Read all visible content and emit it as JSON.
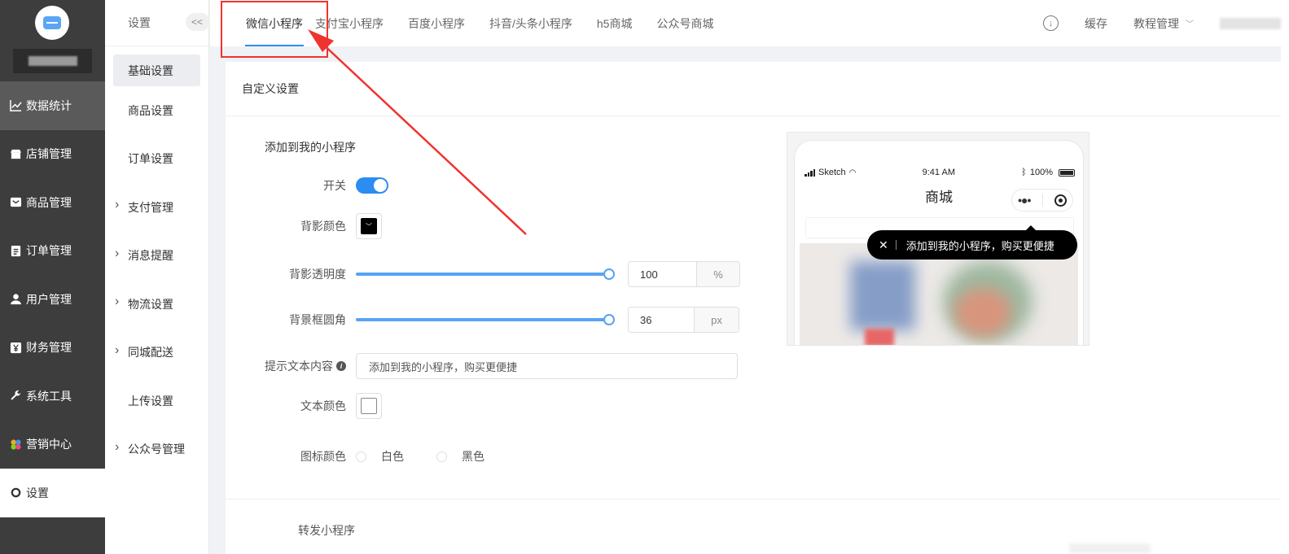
{
  "sidebar": {
    "items": [
      {
        "label": "数据统计",
        "icon": "line-chart-icon"
      },
      {
        "label": "店铺管理",
        "icon": "shop-icon"
      },
      {
        "label": "商品管理",
        "icon": "inbox-icon"
      },
      {
        "label": "订单管理",
        "icon": "clipboard-icon"
      },
      {
        "label": "用户管理",
        "icon": "user-icon"
      },
      {
        "label": "财务管理",
        "icon": "yen-icon"
      },
      {
        "label": "系统工具",
        "icon": "wrench-icon"
      },
      {
        "label": "营销中心",
        "icon": "marketing-icon"
      },
      {
        "label": "设置",
        "icon": "gear-icon"
      }
    ]
  },
  "subnav": {
    "title": "设置",
    "collapse": "<<",
    "items": [
      {
        "label": "基础设置"
      },
      {
        "label": "商品设置"
      },
      {
        "label": "订单设置"
      },
      {
        "label": "支付管理"
      },
      {
        "label": "消息提醒"
      },
      {
        "label": "物流设置"
      },
      {
        "label": "同城配送"
      },
      {
        "label": "上传设置"
      },
      {
        "label": "公众号管理"
      }
    ]
  },
  "tabs": [
    {
      "label": "微信小程序"
    },
    {
      "label": "支付宝小程序"
    },
    {
      "label": "百度小程序"
    },
    {
      "label": "抖音/头条小程序"
    },
    {
      "label": "h5商城"
    },
    {
      "label": "公众号商城"
    }
  ],
  "topright": {
    "cache": "缓存",
    "tutorial": "教程管理"
  },
  "card": {
    "title": "自定义设置",
    "section": "添加到我的小程序",
    "switch_label": "开关",
    "bg_color_label": "背影颜色",
    "bg_color": "#000000",
    "opacity_label": "背影透明度",
    "opacity_value": "100",
    "opacity_unit": "%",
    "radius_label": "背景框圆角",
    "radius_value": "36",
    "radius_unit": "px",
    "tip_label": "提示文本内容",
    "tip_value": "添加到我的小程序，购买更便捷",
    "text_color_label": "文本颜色",
    "text_color": "#ffffff",
    "icon_color_label": "图标颜色",
    "icon_options": [
      "白色",
      "黑色"
    ],
    "forward_label": "转发小程序"
  },
  "preview": {
    "carrier": "Sketch",
    "time": "9:41 AM",
    "battery": "100%",
    "title": "商城",
    "tooltip": "添加到我的小程序，购买更便捷"
  },
  "colors": {
    "accent": "#2d8cf0",
    "annotation": "#f0332e",
    "sidebar_bg": "#3d3d3d"
  }
}
